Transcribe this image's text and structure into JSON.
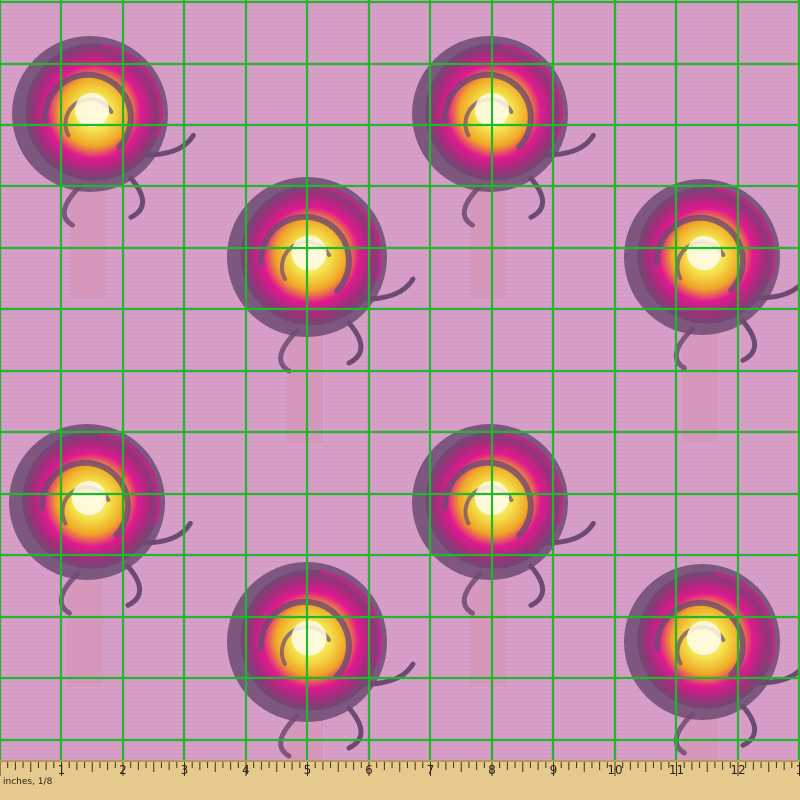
{
  "fabric": {
    "background_color": "#d79ec8",
    "grid_color": "#1fb82c",
    "flower_outer_color": "#6e4a73",
    "flower_mid_color": "#e0198f",
    "flower_inner_color": "#f3e24a",
    "flower_center_color": "#fff6c8"
  },
  "ruler": {
    "unit_label": "inches, 1/8",
    "labels": [
      "1",
      "2",
      "3",
      "4",
      "5",
      "6",
      "7",
      "8",
      "9",
      "10",
      "11",
      "12",
      "1"
    ],
    "wood_color": "#e6c98d"
  }
}
